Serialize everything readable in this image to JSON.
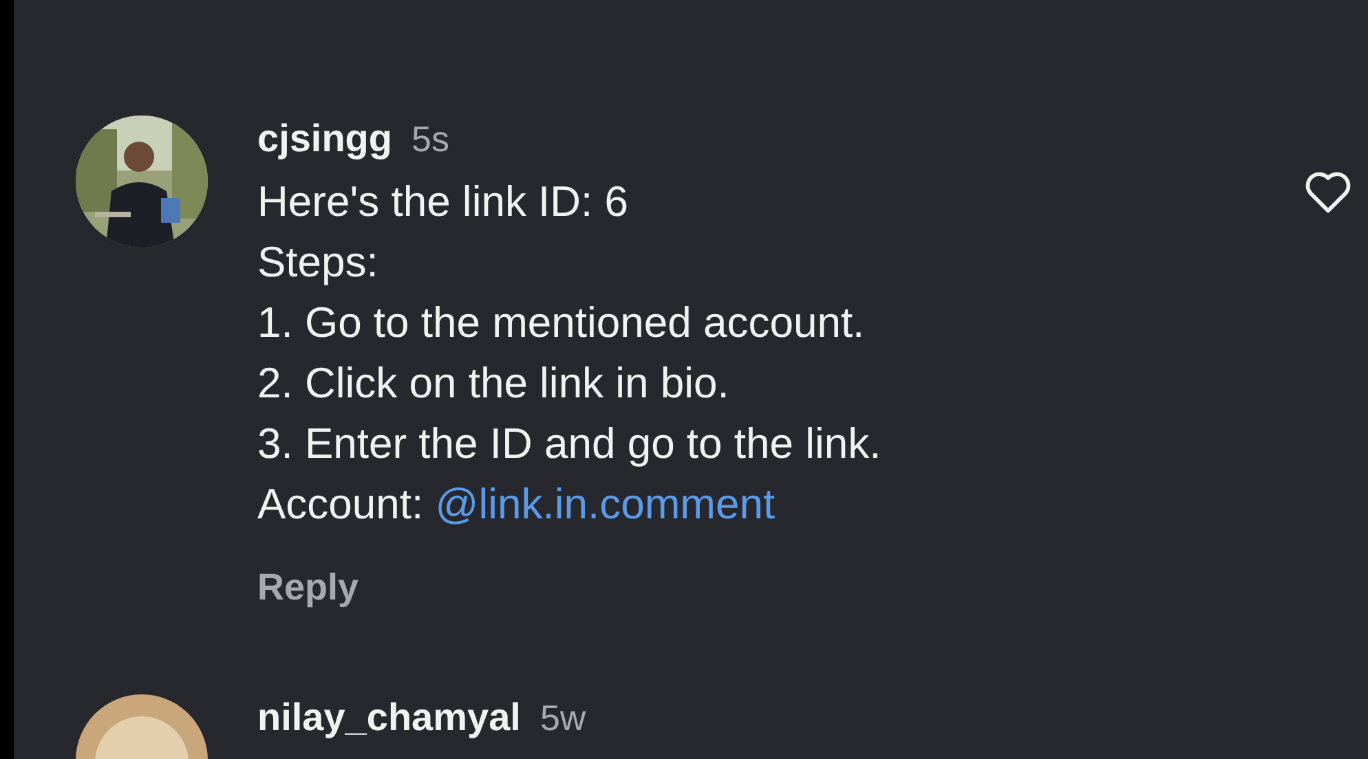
{
  "comments": [
    {
      "kind": "full",
      "username": "cjsingg",
      "time": "5s",
      "liked": false,
      "lines": [
        {
          "text": "Here's the link ID: 6"
        },
        {
          "text": "Steps:"
        },
        {
          "text": "1. Go to the mentioned account."
        },
        {
          "text": "2. Click on the link in bio."
        },
        {
          "text": "3. Enter the ID and go to the link."
        },
        {
          "text": "Account:",
          "link": "@link.in.comment"
        }
      ],
      "reply": "Reply"
    },
    {
      "kind": "header",
      "username": "nilay_chamyal",
      "time": "5w"
    }
  ]
}
